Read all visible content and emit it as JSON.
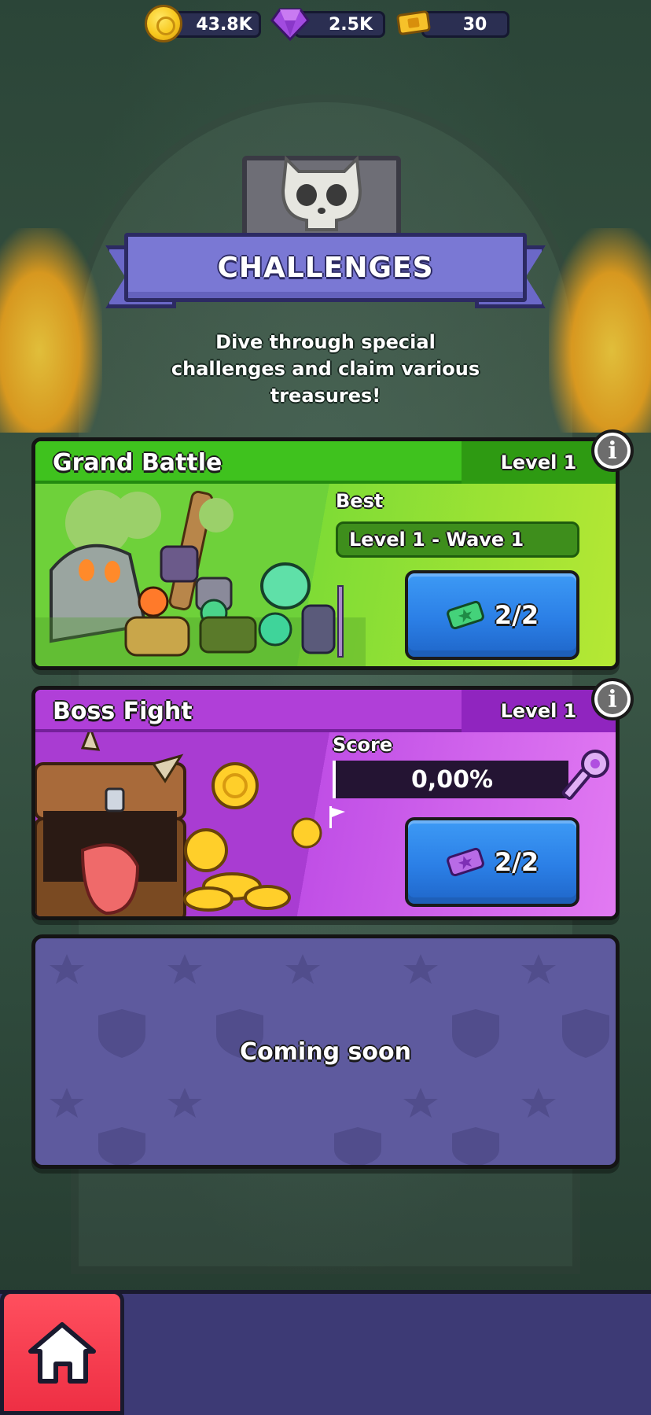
{
  "currencies": {
    "coins": "43.8K",
    "gems": "2.5K",
    "tickets": "30"
  },
  "header": {
    "title": "CHALLENGES",
    "subtitle_line1": "Dive through special",
    "subtitle_line2": "challenges and claim various",
    "subtitle_line3": "treasures!"
  },
  "cards": [
    {
      "title": "Grand Battle",
      "level": "Level 1",
      "field_label": "Best",
      "field_value": "Level 1 - Wave 1",
      "play_count": "2/2",
      "accent": "#2fbf1a"
    },
    {
      "title": "Boss Fight",
      "level": "Level 1",
      "field_label": "Score",
      "field_value": "0,00%",
      "play_count": "2/2",
      "accent": "#b23fdb"
    }
  ],
  "coming_soon": {
    "label": "Coming soon"
  },
  "icons": {
    "info": "i",
    "coin": "coin-icon",
    "gem": "gem-icon",
    "ticket": "ticket-icon",
    "home": "home-icon"
  }
}
